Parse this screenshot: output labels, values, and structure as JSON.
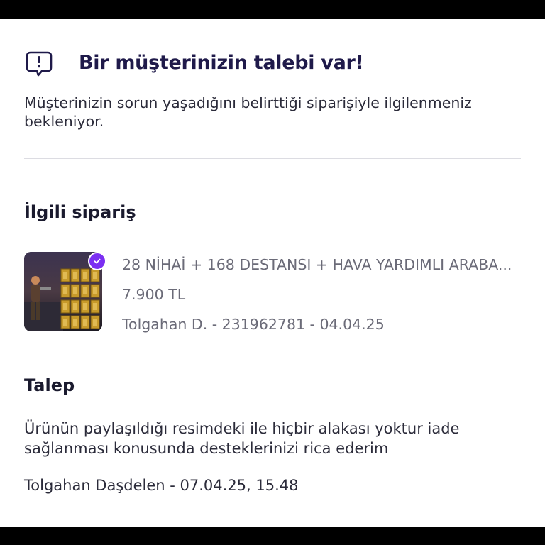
{
  "notice": {
    "title": "Bir müşterinizin talebi var!",
    "description": "Müşterinizin sorun yaşadığını belirttiği siparişiyle ilgilenmeniz bekleniyor.",
    "icon": "alert-message-icon"
  },
  "related_order": {
    "heading": "İlgili sipariş",
    "product_title": "28 NİHAİ + 168 DESTANSI + HAVA YARDIMLI ARABA...",
    "price": "7.900 TL",
    "meta": "Tolgahan D. - 231962781 - 04.04.25",
    "badge_icon": "verified-check-icon",
    "badge_color": "#7b2ff2"
  },
  "request": {
    "heading": "Talep",
    "text": "Ürünün paylaşıldığı resimdeki ile hiçbir alakası yoktur iade sağlanması konusunda desteklerinizi rica ederim",
    "meta": "Tolgahan Daşdelen - 07.04.25, 15.48"
  }
}
